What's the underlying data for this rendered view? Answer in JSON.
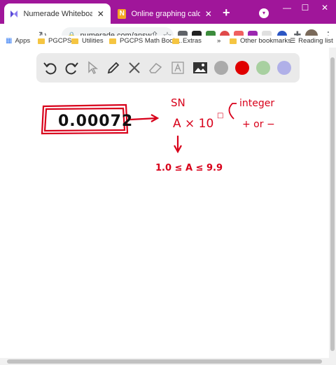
{
  "tabs": [
    {
      "title": "Numerade Whiteboard",
      "active": true,
      "favicon": "numerade-icon"
    },
    {
      "title": "Online graphing calculator — N",
      "active": false,
      "favicon": "N"
    }
  ],
  "address": {
    "url": "numerade.com/answ..."
  },
  "bookmarks": {
    "apps": "Apps",
    "items": [
      "PGCPS",
      "Utilities",
      "PGCPS Math Book...",
      "Extras"
    ],
    "more": "»",
    "other": "Other bookmarks",
    "reading_list": "Reading list"
  },
  "toolbar": {
    "colors": {
      "gray": "#aaaaaa",
      "red": "#e00000",
      "green": "#a8d0a0",
      "lavender": "#b0b0e8"
    }
  },
  "whiteboard": {
    "boxed_number": "0.00072",
    "sn_label": "SN",
    "formula_base": "A × 10",
    "exponent_note": "integer",
    "sign_note": "+ or −",
    "range": "1.0 ≤ A ≤ 9.9",
    "ink_color": "#d8001a"
  }
}
